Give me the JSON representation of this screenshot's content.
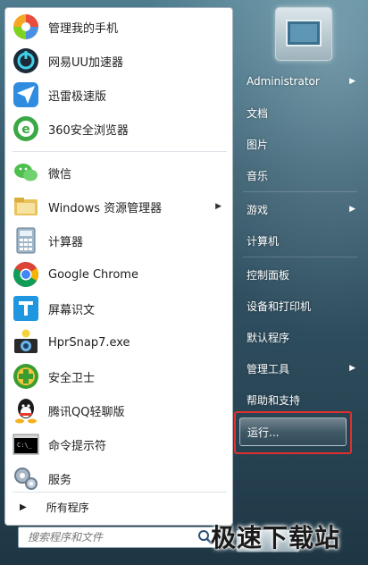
{
  "left_pane": {
    "apps": [
      {
        "label": "管理我的手机",
        "icon": "phone-manager-icon",
        "arrow": false
      },
      {
        "label": "网易UU加速器",
        "icon": "uu-accelerator-icon",
        "arrow": false
      },
      {
        "label": "迅雷极速版",
        "icon": "thunder-icon",
        "arrow": false
      },
      {
        "label": "360安全浏览器",
        "icon": "360-browser-icon",
        "arrow": false
      },
      {
        "label": "微信",
        "icon": "wechat-icon",
        "arrow": false
      },
      {
        "label": "Windows 资源管理器",
        "icon": "explorer-icon",
        "arrow": true
      },
      {
        "label": "计算器",
        "icon": "calculator-icon",
        "arrow": false
      },
      {
        "label": "Google Chrome",
        "icon": "chrome-icon",
        "arrow": false
      },
      {
        "label": "屏幕识文",
        "icon": "screen-ocr-icon",
        "arrow": false
      },
      {
        "label": "HprSnap7.exe",
        "icon": "hypersnap-icon",
        "arrow": false
      },
      {
        "label": "安全卫士",
        "icon": "security-guard-icon",
        "arrow": false
      },
      {
        "label": "腾讯QQ轻聊版",
        "icon": "qq-icon",
        "arrow": false
      },
      {
        "label": "命令提示符",
        "icon": "cmd-icon",
        "arrow": false
      },
      {
        "label": "服务",
        "icon": "services-icon",
        "arrow": false
      }
    ],
    "all_programs": "所有程序",
    "search_placeholder": "搜索程序和文件"
  },
  "right_pane": {
    "items": [
      {
        "label": "Administrator",
        "arrow": true
      },
      {
        "label": "文档",
        "arrow": false
      },
      {
        "label": "图片",
        "arrow": false
      },
      {
        "label": "音乐",
        "arrow": false
      },
      {
        "label": "游戏",
        "arrow": true
      },
      {
        "label": "计算机",
        "arrow": false
      },
      {
        "label": "控制面板",
        "arrow": false
      },
      {
        "label": "设备和打印机",
        "arrow": false
      },
      {
        "label": "默认程序",
        "arrow": false
      },
      {
        "label": "管理工具",
        "arrow": true
      },
      {
        "label": "帮助和支持",
        "arrow": false
      }
    ],
    "run_label": "运行..."
  },
  "watermark": "极速下载站",
  "colors": {
    "highlight_border": "#e0302e",
    "left_bg": "#ffffff",
    "right_bg": "#35596b"
  }
}
